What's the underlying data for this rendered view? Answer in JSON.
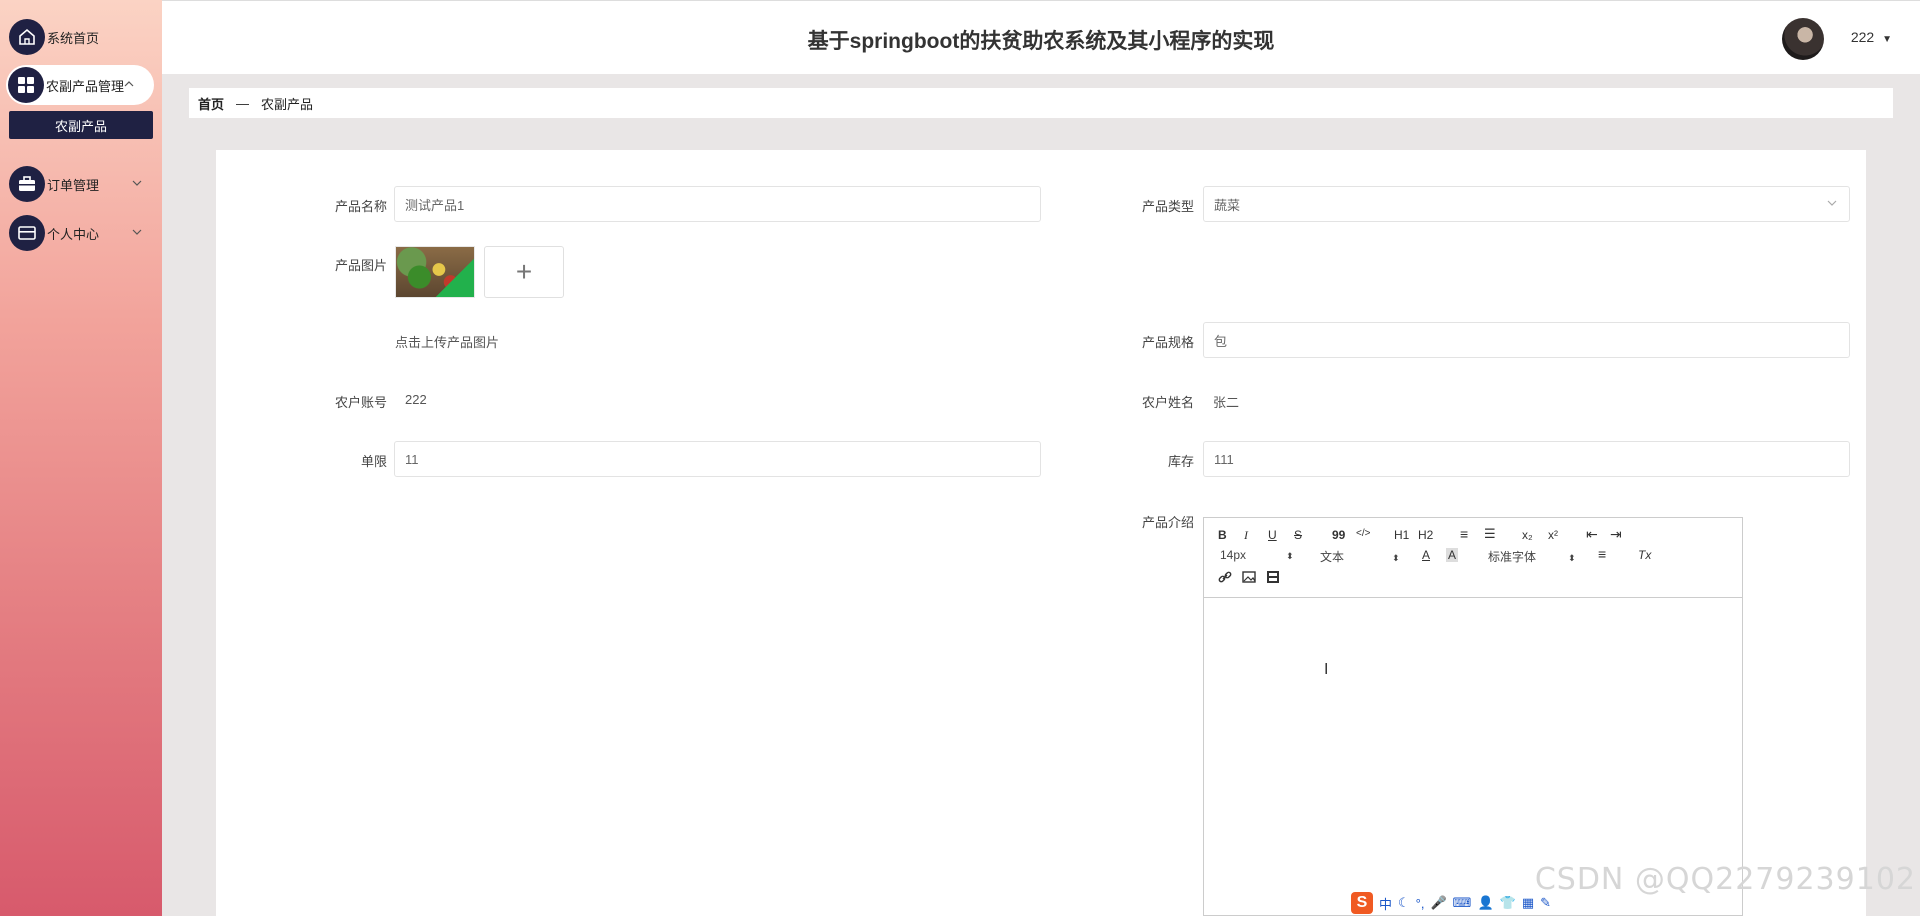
{
  "app": {
    "title": "基于springboot的扶贫助农系统及其小程序的实现"
  },
  "header": {
    "username": "222",
    "dropdown_icon": "caret-down-icon"
  },
  "sidebar": {
    "items": [
      {
        "label": "系统首页",
        "icon": "home-icon"
      },
      {
        "label": "农副产品管理",
        "icon": "grid-icon",
        "arrow": "^"
      },
      {
        "label": "订单管理",
        "icon": "briefcase-icon",
        "arrow": "v"
      },
      {
        "label": "个人中心",
        "icon": "card-icon",
        "arrow": "v"
      }
    ],
    "submenu": {
      "label": "农副产品"
    }
  },
  "breadcrumb": {
    "home": "首页",
    "separator": "—",
    "current": "农副产品"
  },
  "form": {
    "product_name": {
      "label": "产品名称",
      "value": "测试产品1"
    },
    "product_type": {
      "label": "产品类型",
      "value": "蔬菜"
    },
    "product_image": {
      "label": "产品图片",
      "hint": "点击上传产品图片",
      "upload_symbol": "+"
    },
    "product_spec": {
      "label": "产品规格",
      "value": "包"
    },
    "farmer_account": {
      "label": "农户账号",
      "value": "222"
    },
    "farmer_name": {
      "label": "农户姓名",
      "value": "张二"
    },
    "limit": {
      "label": "单限",
      "value": "11"
    },
    "stock": {
      "label": "库存",
      "value": "111"
    },
    "intro": {
      "label": "产品介绍"
    }
  },
  "editor": {
    "toolbar": {
      "bold": "B",
      "italic": "I",
      "underline": "U",
      "strike": "S",
      "quote": "99",
      "code": "</>",
      "h1": "H1",
      "h2": "H2",
      "ol": "≡",
      "ul": "☰",
      "sub": "x₂",
      "sup": "x²",
      "outdent": "⇤",
      "indent": "⇥",
      "size": "14px",
      "header": "文本",
      "font": "标准字体",
      "color": "A",
      "background": "A",
      "align": "≡",
      "clean": "Tx",
      "link": "🔗",
      "image": "▣",
      "video": "▤"
    }
  },
  "ime": {
    "mode": "中"
  },
  "watermark": "CSDN @QQ2279239102"
}
